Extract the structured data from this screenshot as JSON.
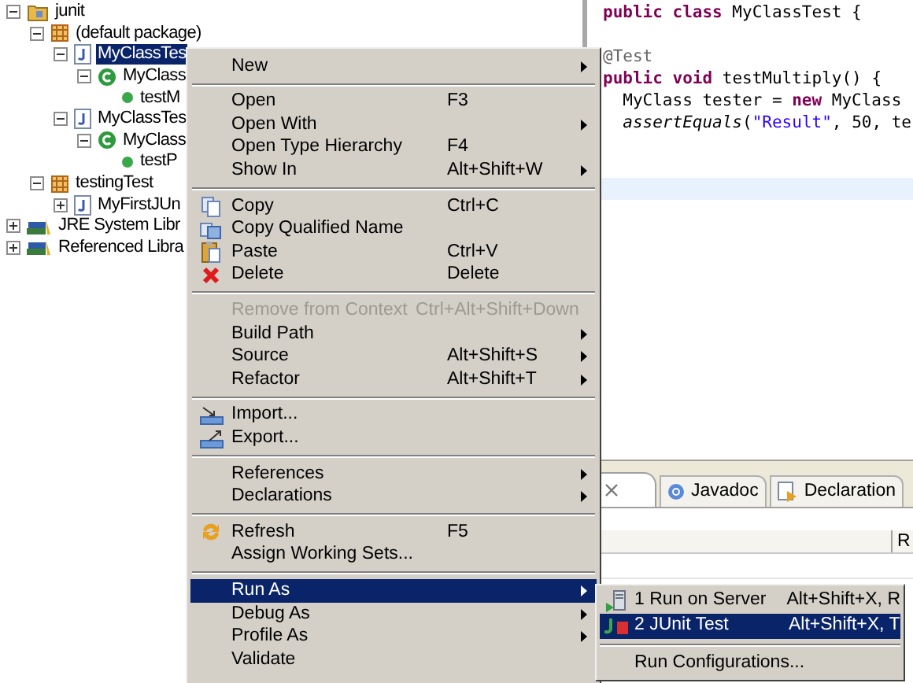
{
  "tree": [
    {
      "label": "junit",
      "kind": "project",
      "expanded": true,
      "selected": false,
      "children": [
        {
          "label": "(default package)",
          "kind": "package",
          "expanded": true,
          "selected": false,
          "children": [
            {
              "label": "MyClassTes",
              "kind": "file",
              "expanded": true,
              "selected": true,
              "children": [
                {
                  "label": "MyClass",
                  "kind": "class",
                  "expanded": true,
                  "selected": false,
                  "children": [
                    {
                      "label": "testM",
                      "kind": "method",
                      "selected": false
                    }
                  ]
                }
              ]
            },
            {
              "label": "MyClassTes",
              "kind": "file",
              "expanded": true,
              "selected": false,
              "children": [
                {
                  "label": "MyClass",
                  "kind": "class",
                  "expanded": true,
                  "selected": false,
                  "children": [
                    {
                      "label": "testP",
                      "kind": "method",
                      "selected": false
                    }
                  ]
                }
              ]
            }
          ]
        },
        {
          "label": "testingTest",
          "kind": "package",
          "expanded": true,
          "selected": false,
          "children": [
            {
              "label": "MyFirstJUn",
              "kind": "file",
              "expanded": false,
              "selected": false
            }
          ]
        }
      ]
    },
    {
      "label": "JRE System Libr",
      "kind": "library",
      "expanded": false,
      "selected": false
    },
    {
      "label": "Referenced Libra",
      "kind": "library",
      "expanded": false,
      "selected": false
    }
  ],
  "editor": {
    "current_line": true,
    "lines": [
      {
        "tokens": [
          {
            "text": "public class",
            "kind": "keyword"
          },
          {
            "text": " MyClassTest {",
            "kind": "plain"
          }
        ]
      },
      {
        "kind": "blank"
      },
      {
        "tokens": [
          {
            "text": "@Test",
            "kind": "annotation"
          }
        ]
      },
      {
        "tokens": [
          {
            "text": "public void",
            "kind": "keyword"
          },
          {
            "text": " testMultiply() {",
            "kind": "plain"
          }
        ]
      },
      {
        "tokens": [
          {
            "text": "  MyClass tester = ",
            "kind": "plain"
          },
          {
            "text": "new",
            "kind": "keyword"
          },
          {
            "text": " MyClass",
            "kind": "plain"
          }
        ]
      },
      {
        "tokens": [
          {
            "text": "  assertEquals",
            "kind": "static"
          },
          {
            "text": "(",
            "kind": "plain"
          },
          {
            "text": "\"Result\"",
            "kind": "string"
          },
          {
            "text": ", 50, te",
            "kind": "plain"
          }
        ]
      }
    ]
  },
  "bottom_panel": {
    "tabs": [
      {
        "label": "Javadoc",
        "selected": false
      },
      {
        "label": "Declaration",
        "selected": false
      }
    ],
    "column_2": "R"
  },
  "context_menu": {
    "groups": [
      [
        {
          "label": "New",
          "submenu": true,
          "disabled": false,
          "selected": false
        }
      ],
      [
        {
          "label": "Open",
          "shortcut": "F3",
          "submenu": false,
          "disabled": false,
          "selected": false
        },
        {
          "label": "Open With",
          "submenu": true,
          "disabled": false,
          "selected": false
        },
        {
          "label": "Open Type Hierarchy",
          "shortcut": "F4",
          "submenu": false,
          "disabled": false,
          "selected": false
        },
        {
          "label": "Show In",
          "shortcut": "Alt+Shift+W",
          "submenu": true,
          "disabled": false,
          "selected": false
        }
      ],
      [
        {
          "label": "Copy",
          "shortcut": "Ctrl+C",
          "submenu": false,
          "disabled": false,
          "selected": false
        },
        {
          "label": "Copy Qualified Name",
          "submenu": false,
          "disabled": false,
          "selected": false
        },
        {
          "label": "Paste",
          "shortcut": "Ctrl+V",
          "submenu": false,
          "disabled": false,
          "selected": false
        },
        {
          "label": "Delete",
          "shortcut": "Delete",
          "submenu": false,
          "disabled": false,
          "selected": false
        }
      ],
      [
        {
          "label": "Remove from Context",
          "shortcut": "Ctrl+Alt+Shift+Down",
          "submenu": false,
          "disabled": true,
          "selected": false
        },
        {
          "label": "Build Path",
          "submenu": true,
          "disabled": false,
          "selected": false
        },
        {
          "label": "Source",
          "shortcut": "Alt+Shift+S",
          "submenu": true,
          "disabled": false,
          "selected": false
        },
        {
          "label": "Refactor",
          "shortcut": "Alt+Shift+T",
          "submenu": true,
          "disabled": false,
          "selected": false
        }
      ],
      [
        {
          "label": "Import...",
          "submenu": false,
          "disabled": false,
          "selected": false
        },
        {
          "label": "Export...",
          "submenu": false,
          "disabled": false,
          "selected": false
        }
      ],
      [
        {
          "label": "References",
          "submenu": true,
          "disabled": false,
          "selected": false
        },
        {
          "label": "Declarations",
          "submenu": true,
          "disabled": false,
          "selected": false
        }
      ],
      [
        {
          "label": "Refresh",
          "shortcut": "F5",
          "submenu": false,
          "disabled": false,
          "selected": false
        },
        {
          "label": "Assign Working Sets...",
          "submenu": false,
          "disabled": false,
          "selected": false
        }
      ],
      [
        {
          "label": "Run As",
          "submenu": true,
          "disabled": false,
          "selected": true
        },
        {
          "label": "Debug As",
          "submenu": true,
          "disabled": false,
          "selected": false
        },
        {
          "label": "Profile As",
          "submenu": true,
          "disabled": false,
          "selected": false
        },
        {
          "label": "Validate",
          "submenu": false,
          "disabled": false,
          "selected": false
        }
      ]
    ]
  },
  "submenu": {
    "groups": [
      [
        {
          "label": "1 Run on Server",
          "shortcut": "Alt+Shift+X, R",
          "selected": false
        },
        {
          "label": "2 JUnit Test",
          "shortcut": "Alt+Shift+X, T",
          "selected": true
        }
      ],
      [
        {
          "label": "Run Configurations...",
          "selected": false
        }
      ]
    ]
  }
}
